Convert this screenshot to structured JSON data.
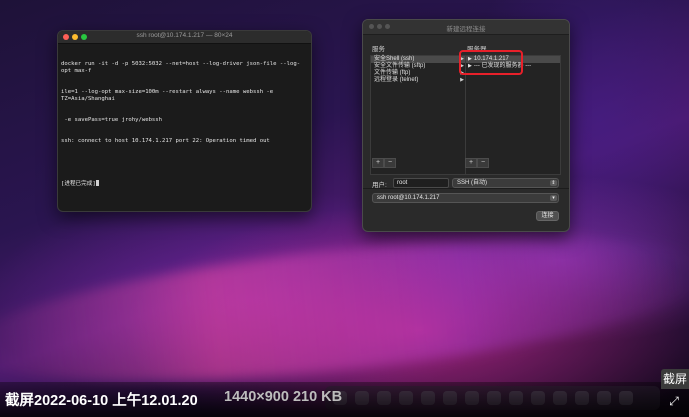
{
  "terminal": {
    "title": "ssh root@10.174.1.217 — 80×24",
    "lines": [
      "docker run -it -d -p 5032:5032 --net=host --log-driver json-file --log-opt max-f",
      "ile=1 --log-opt max-size=100m --restart always --name webssh -e TZ=Asia/Shanghai",
      " -e savePass=true jrohy/webssh",
      "ssh: connect to host 10.174.1.217 port 22: Operation timed out",
      "",
      "[进程已完成]"
    ]
  },
  "dialog": {
    "title": "新建远程连接",
    "services_header": "服务",
    "servers_header": "服务器",
    "services": [
      {
        "label": "安全Shell (ssh)",
        "selected": true
      },
      {
        "label": "安全文件传输 (sftp)",
        "selected": false
      },
      {
        "label": "文件传输 (ftp)",
        "selected": false
      },
      {
        "label": "远程登录 (telnet)",
        "selected": false
      }
    ],
    "servers": [
      {
        "label": "10.174.1.217",
        "selected": true
      },
      {
        "label": "--- 已发现的服务器 ---",
        "selected": false
      }
    ],
    "add_label": "+",
    "remove_label": "−",
    "user_label": "用户:",
    "user_value": "root",
    "protocol_value": "SSH (自动)",
    "command_value": "ssh root@10.174.1.217",
    "connect_label": "连接"
  },
  "info_bar": {
    "filename": "截屏2022-06-10 上午12.01.20",
    "meta": "1440×900 210 KB",
    "badge": "截屏",
    "expand_icon": "expand-icon"
  },
  "colors": {
    "highlight_box": "#e8202a"
  }
}
